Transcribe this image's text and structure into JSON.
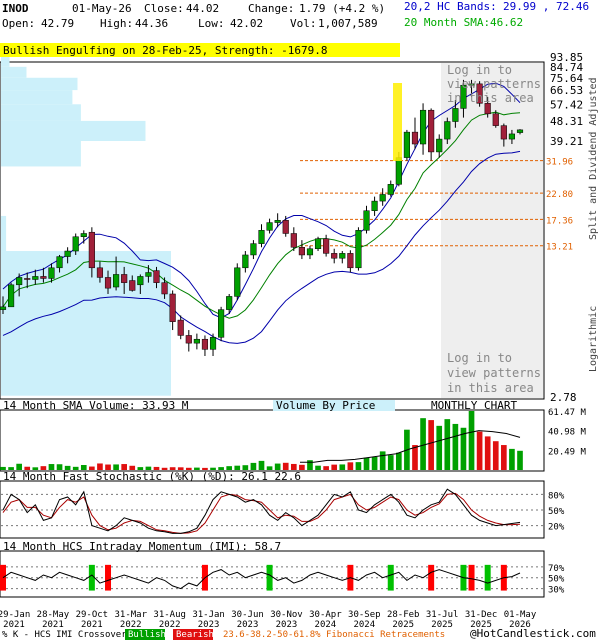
{
  "header": {
    "symbol": "INOD",
    "date": "01-May-26",
    "open_label": "Open:",
    "open": "42.79",
    "close_label": "Close:",
    "close": "44.02",
    "high_label": "High:",
    "high": "44.36",
    "low_label": "Low:",
    "low": "42.02",
    "change_label": "Change:",
    "change": "1.79 (+4.2 %)",
    "vol_label": "Vol:",
    "vol": "1,007,589",
    "bands_label": "20,2 HC Bands:",
    "bands": "29.99 , 72.46",
    "sma_label": "20 Month SMA:",
    "sma": "46.62"
  },
  "pattern_banner": "Bullish Engulfing on 28-Feb-25, Strength: -1679.8",
  "side_label_top": "Split and Dividend Adjusted",
  "side_label_bottom": "Logarithmic",
  "login_text_top": [
    "Log in to",
    "view patterns",
    "in this area"
  ],
  "login_text_bottom": [
    "Log in to",
    "view patterns",
    "in this area"
  ],
  "panel_labels": {
    "volume": "14 Month SMA Volume: 33.93 M",
    "vbp": "Volume By Price",
    "chart_type": "MONTHLY CHART",
    "stoch": "14 Month Fast Stochastic (%K) (%D): 26.1  22.6",
    "imi": "14 Month HCS Intraday Momentum (IMI): 58.7"
  },
  "footer": {
    "legend_prefix": "% K - HCS IMI Crossover:",
    "bullish": "Bullish",
    "bearish": "Bearish",
    "fib": "23.6-38.2-50-61.8% Fibonacci Retracements",
    "copyright": "@HotCandlestick.com"
  },
  "colors": {
    "up": "#00a000",
    "down": "#a0203a",
    "candle_border": "#000000",
    "upper_band": "#0000aa",
    "sma": "#008000",
    "vbp": "#ccf0fa",
    "banner": "#ffff00",
    "fib": "#e06000",
    "header_blue": "#0000cc",
    "header_green": "#00aa00",
    "stoch_k": "#000000",
    "stoch_d": "#aa0000"
  },
  "chart_data": {
    "type": "candlestick",
    "scale": "log",
    "price_ticks": [
      93.85,
      84.74,
      75.64,
      66.53,
      57.42,
      48.31,
      39.21,
      2.78
    ],
    "fib_levels": [
      31.96,
      22.8,
      17.36,
      13.21
    ],
    "x_ticks": [
      "29-Jan 2021",
      "28-May 2021",
      "29-Oct 2021",
      "31-Mar 2022",
      "31-Aug 2022",
      "31-Jan 2023",
      "30-Jun 2023",
      "30-Nov 2023",
      "30-Apr 2024",
      "30-Sep 2024",
      "28-Feb 2025",
      "31-Jul 2025",
      "31-Dec 2025",
      "01-May 2026"
    ],
    "candles": [
      {
        "o": 6.8,
        "h": 7.8,
        "l": 6.5,
        "c": 7.0
      },
      {
        "o": 7.0,
        "h": 9.0,
        "l": 7.0,
        "c": 8.8
      },
      {
        "o": 8.8,
        "h": 9.9,
        "l": 7.8,
        "c": 9.5
      },
      {
        "o": 9.4,
        "h": 10.0,
        "l": 8.5,
        "c": 9.3
      },
      {
        "o": 9.3,
        "h": 10.3,
        "l": 8.8,
        "c": 9.6
      },
      {
        "o": 9.6,
        "h": 10.5,
        "l": 9.0,
        "c": 9.4
      },
      {
        "o": 9.4,
        "h": 11.0,
        "l": 9.0,
        "c": 10.5
      },
      {
        "o": 10.5,
        "h": 12.0,
        "l": 10.0,
        "c": 11.8
      },
      {
        "o": 11.8,
        "h": 13.0,
        "l": 11.0,
        "c": 12.5
      },
      {
        "o": 12.5,
        "h": 15.0,
        "l": 12.0,
        "c": 14.5
      },
      {
        "o": 14.5,
        "h": 15.5,
        "l": 13.5,
        "c": 15.0
      },
      {
        "o": 15.2,
        "h": 16.0,
        "l": 9.5,
        "c": 10.5
      },
      {
        "o": 10.5,
        "h": 11.2,
        "l": 9.0,
        "c": 9.5
      },
      {
        "o": 9.5,
        "h": 10.2,
        "l": 8.0,
        "c": 8.5
      },
      {
        "o": 8.6,
        "h": 11.8,
        "l": 8.3,
        "c": 9.8
      },
      {
        "o": 9.8,
        "h": 10.6,
        "l": 8.0,
        "c": 9.0
      },
      {
        "o": 9.2,
        "h": 9.7,
        "l": 8.2,
        "c": 8.3
      },
      {
        "o": 8.8,
        "h": 9.8,
        "l": 8.0,
        "c": 9.6
      },
      {
        "o": 9.6,
        "h": 10.8,
        "l": 9.0,
        "c": 10.0
      },
      {
        "o": 10.2,
        "h": 10.6,
        "l": 8.5,
        "c": 9.0
      },
      {
        "o": 9.0,
        "h": 9.5,
        "l": 7.6,
        "c": 8.0
      },
      {
        "o": 8.0,
        "h": 8.3,
        "l": 5.5,
        "c": 6.0
      },
      {
        "o": 6.1,
        "h": 6.4,
        "l": 5.0,
        "c": 5.2
      },
      {
        "o": 5.2,
        "h": 5.5,
        "l": 4.4,
        "c": 4.8
      },
      {
        "o": 4.8,
        "h": 5.3,
        "l": 4.5,
        "c": 5.0
      },
      {
        "o": 5.0,
        "h": 5.2,
        "l": 4.2,
        "c": 4.5
      },
      {
        "o": 4.5,
        "h": 5.3,
        "l": 4.2,
        "c": 5.1
      },
      {
        "o": 5.1,
        "h": 7.0,
        "l": 4.9,
        "c": 6.8
      },
      {
        "o": 6.8,
        "h": 8.0,
        "l": 6.5,
        "c": 7.8
      },
      {
        "o": 7.8,
        "h": 11.0,
        "l": 7.5,
        "c": 10.5
      },
      {
        "o": 10.5,
        "h": 12.5,
        "l": 10.0,
        "c": 12.0
      },
      {
        "o": 12.0,
        "h": 14.0,
        "l": 11.5,
        "c": 13.5
      },
      {
        "o": 13.5,
        "h": 16.5,
        "l": 13.0,
        "c": 15.5
      },
      {
        "o": 15.5,
        "h": 17.5,
        "l": 15.0,
        "c": 16.8
      },
      {
        "o": 16.8,
        "h": 18.5,
        "l": 16.0,
        "c": 17.2
      },
      {
        "o": 17.2,
        "h": 18.0,
        "l": 14.5,
        "c": 15.0
      },
      {
        "o": 15.0,
        "h": 16.0,
        "l": 12.5,
        "c": 13.0
      },
      {
        "o": 13.0,
        "h": 14.0,
        "l": 11.5,
        "c": 12.0
      },
      {
        "o": 12.0,
        "h": 13.2,
        "l": 11.5,
        "c": 12.8
      },
      {
        "o": 12.8,
        "h": 14.5,
        "l": 12.5,
        "c": 14.2
      },
      {
        "o": 14.2,
        "h": 14.8,
        "l": 11.8,
        "c": 12.2
      },
      {
        "o": 12.2,
        "h": 12.8,
        "l": 11.0,
        "c": 11.6
      },
      {
        "o": 11.6,
        "h": 12.5,
        "l": 11.0,
        "c": 12.2
      },
      {
        "o": 12.2,
        "h": 12.6,
        "l": 10.0,
        "c": 10.5
      },
      {
        "o": 10.5,
        "h": 16.0,
        "l": 10.2,
        "c": 15.5
      },
      {
        "o": 15.5,
        "h": 20.0,
        "l": 15.0,
        "c": 19.0
      },
      {
        "o": 19.0,
        "h": 22.0,
        "l": 18.0,
        "c": 21.0
      },
      {
        "o": 21.0,
        "h": 24.0,
        "l": 20.0,
        "c": 22.5
      },
      {
        "o": 22.5,
        "h": 26.0,
        "l": 22.0,
        "c": 25.0
      },
      {
        "o": 25.0,
        "h": 35.0,
        "l": 24.5,
        "c": 33.0
      },
      {
        "o": 33.0,
        "h": 44.0,
        "l": 32.0,
        "c": 43.0
      },
      {
        "o": 43.0,
        "h": 50.0,
        "l": 36.0,
        "c": 38.0
      },
      {
        "o": 38.0,
        "h": 58.0,
        "l": 34.0,
        "c": 54.0
      },
      {
        "o": 54.0,
        "h": 55.0,
        "l": 32.0,
        "c": 35.0
      },
      {
        "o": 35.0,
        "h": 42.0,
        "l": 33.0,
        "c": 40.0
      },
      {
        "o": 40.0,
        "h": 50.0,
        "l": 38.0,
        "c": 48.0
      },
      {
        "o": 48.0,
        "h": 60.0,
        "l": 45.0,
        "c": 55.0
      },
      {
        "o": 55.0,
        "h": 74.0,
        "l": 50.0,
        "c": 70.0
      },
      {
        "o": 70.0,
        "h": 74.0,
        "l": 62.0,
        "c": 71.0
      },
      {
        "o": 71.0,
        "h": 73.0,
        "l": 56.0,
        "c": 58.0
      },
      {
        "o": 58.0,
        "h": 62.0,
        "l": 50.0,
        "c": 52.0
      },
      {
        "o": 52.0,
        "h": 54.0,
        "l": 45.0,
        "c": 46.0
      },
      {
        "o": 46.0,
        "h": 47.0,
        "l": 37.0,
        "c": 40.0
      },
      {
        "o": 40.0,
        "h": 44.0,
        "l": 38.0,
        "c": 42.2
      },
      {
        "o": 42.79,
        "h": 44.36,
        "l": 42.02,
        "c": 44.02
      }
    ],
    "volume_values": [
      3.2,
      3.0,
      6.5,
      3.4,
      2.8,
      4.0,
      6.2,
      6.0,
      4.3,
      3.3,
      5.2,
      3.6,
      6.8,
      5.7,
      5.8,
      6.2,
      4.4,
      3.0,
      3.5,
      3.2,
      2.3,
      2.9,
      2.8,
      2.3,
      2.5,
      2.2,
      2.4,
      3.0,
      4.0,
      4.5,
      5.0,
      7.4,
      9.5,
      3.8,
      6.7,
      7.5,
      6.3,
      5.4,
      10.2,
      4.5,
      4.0,
      5.6,
      5.8,
      8.0,
      8.2,
      12.8,
      13.6,
      19.4,
      15.5,
      18.0,
      42.0,
      26.0,
      54.0,
      52.0,
      46.0,
      53.0,
      48.0,
      44.0,
      61.47,
      40.0,
      35.0,
      30.0,
      26.0,
      22.0,
      20.0
    ],
    "volume_ticks": [
      "61.47 M",
      "40.98 M",
      "20.49 M"
    ],
    "volume_sma": [
      8,
      8,
      10,
      10,
      11,
      13,
      15,
      17,
      22,
      26,
      30,
      34,
      38,
      41,
      40,
      38,
      34
    ],
    "volume_by_price": [
      {
        "from": 84.74,
        "to": 93.85,
        "size": 0.05
      },
      {
        "from": 75.64,
        "to": 84.74,
        "size": 0.15
      },
      {
        "from": 66.53,
        "to": 75.64,
        "size": 0.45
      },
      {
        "from": 57.42,
        "to": 66.53,
        "size": 0.42
      },
      {
        "from": 48.31,
        "to": 57.42,
        "size": 0.47
      },
      {
        "from": 39.21,
        "to": 48.31,
        "size": 0.85
      },
      {
        "from": 30.1,
        "to": 39.21,
        "size": 0.47
      },
      {
        "from": 18.0,
        "to": 30.1,
        "size": 0.0
      },
      {
        "from": 12.5,
        "to": 18.0,
        "size": 0.03
      },
      {
        "from": 2.78,
        "to": 12.5,
        "size": 1.0
      }
    ],
    "stoch_ticks": [
      "80%",
      "50%",
      "20%"
    ],
    "stoch_k": [
      50,
      80,
      70,
      45,
      60,
      30,
      35,
      70,
      75,
      60,
      85,
      20,
      15,
      10,
      20,
      35,
      30,
      25,
      15,
      10,
      8,
      5,
      5,
      8,
      15,
      40,
      70,
      85,
      80,
      75,
      65,
      70,
      60,
      40,
      30,
      45,
      35,
      20,
      30,
      40,
      60,
      80,
      75,
      85,
      50,
      45,
      60,
      70,
      80,
      65,
      40,
      35,
      50,
      60,
      65,
      90,
      80,
      60,
      40,
      30,
      25,
      20,
      22,
      24,
      26.1
    ],
    "stoch_d": [
      45,
      65,
      70,
      55,
      55,
      40,
      35,
      55,
      70,
      65,
      75,
      40,
      20,
      12,
      15,
      25,
      30,
      28,
      20,
      12,
      10,
      7,
      5,
      6,
      10,
      25,
      50,
      75,
      80,
      78,
      70,
      68,
      65,
      50,
      35,
      40,
      38,
      28,
      28,
      35,
      50,
      70,
      75,
      80,
      60,
      50,
      55,
      65,
      75,
      70,
      50,
      40,
      45,
      55,
      62,
      80,
      82,
      70,
      50,
      38,
      30,
      25,
      22,
      22,
      22.6
    ],
    "imi_ticks": [
      "70%",
      "50%",
      "30%"
    ],
    "imi_values": [
      50,
      60,
      55,
      50,
      45,
      55,
      50,
      60,
      55,
      50,
      45,
      55,
      40,
      45,
      50,
      55,
      50,
      45,
      40,
      50,
      45,
      35,
      30,
      40,
      35,
      50,
      60,
      65,
      55,
      60,
      50,
      55,
      60,
      55,
      45,
      50,
      40,
      45,
      55,
      60,
      55,
      50,
      45,
      50,
      45,
      55,
      60,
      50,
      55,
      60,
      45,
      55,
      50,
      60,
      65,
      60,
      55,
      50,
      48,
      45,
      40,
      45,
      50,
      52,
      58.7
    ],
    "crossover_marks": [
      {
        "index": 0,
        "type": "bearish"
      },
      {
        "index": 11,
        "type": "bullish"
      },
      {
        "index": 13,
        "type": "bearish"
      },
      {
        "index": 25,
        "type": "bearish"
      },
      {
        "index": 33,
        "type": "bullish"
      },
      {
        "index": 43,
        "type": "bearish"
      },
      {
        "index": 48,
        "type": "bullish"
      },
      {
        "index": 53,
        "type": "bearish"
      },
      {
        "index": 57,
        "type": "bullish"
      },
      {
        "index": 58,
        "type": "bearish"
      },
      {
        "index": 60,
        "type": "bullish"
      },
      {
        "index": 62,
        "type": "bearish"
      }
    ]
  }
}
